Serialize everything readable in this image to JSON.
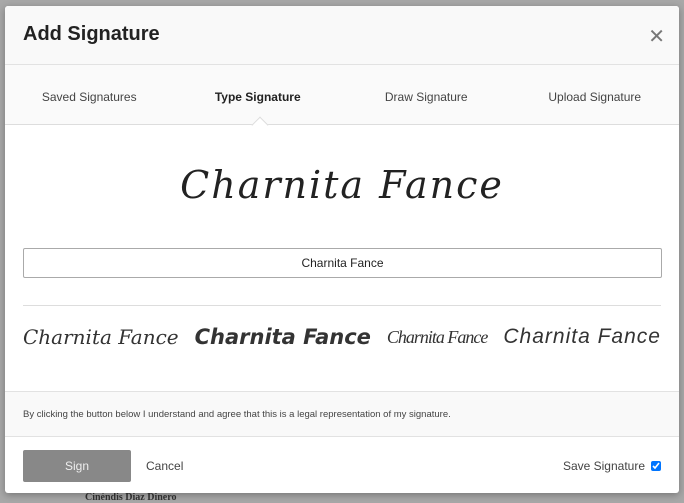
{
  "background": {
    "text": "Cinéndis Diaz Dinero"
  },
  "dialog": {
    "title": "Add Signature",
    "close_icon": "close-icon",
    "tabs": [
      {
        "label": "Saved Signatures",
        "active": false
      },
      {
        "label": "Type Signature",
        "active": true
      },
      {
        "label": "Draw Signature",
        "active": false
      },
      {
        "label": "Upload Signature",
        "active": false
      }
    ],
    "preview": "Charnita Fance",
    "input_value": "Charnita Fance",
    "style_options": [
      "Charnita Fance",
      "Charnita Fance",
      "Charnita Fance",
      "Charnita Fance"
    ],
    "disclaimer": "By clicking the button below I understand and agree that this is a legal representation of my signature.",
    "sign_label": "Sign",
    "cancel_label": "Cancel",
    "save_signature_label": "Save Signature",
    "save_signature_checked": true
  }
}
